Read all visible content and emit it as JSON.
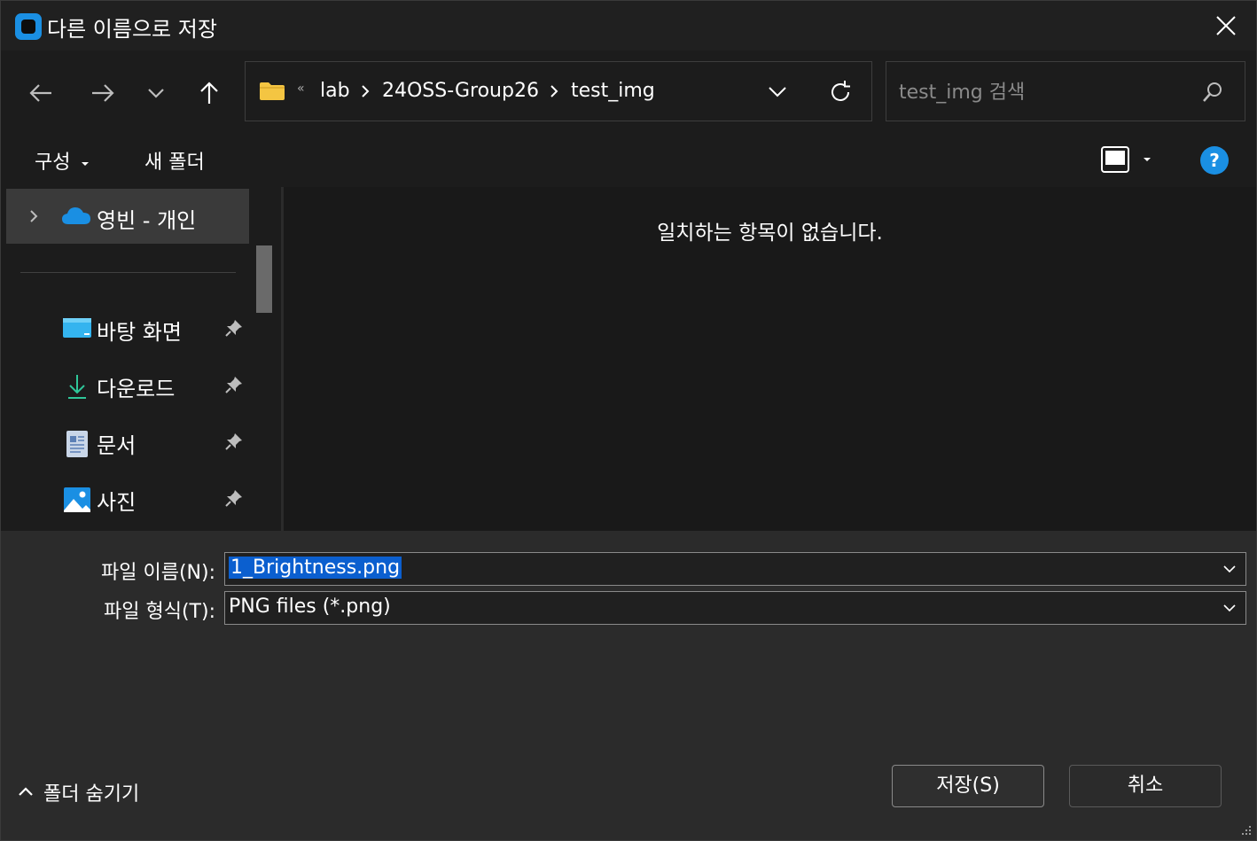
{
  "title": "다른 이름으로 저장",
  "nav": {
    "back": "arrow-left-icon",
    "forward": "arrow-right-icon",
    "recent": "chevron-down-icon",
    "up": "arrow-up-icon"
  },
  "address": {
    "overflow": "«",
    "crumbs": [
      "lab",
      "24OSS-Group26",
      "test_img"
    ]
  },
  "search": {
    "placeholder": "test_img 검색"
  },
  "toolbar": {
    "organize": "구성",
    "new_folder": "새 폴더",
    "help": "?"
  },
  "sidebar": {
    "onedrive": "영빈 - 개인",
    "quick_access": [
      {
        "label": "바탕 화면",
        "icon": "desktop-icon"
      },
      {
        "label": "다운로드",
        "icon": "download-icon"
      },
      {
        "label": "문서",
        "icon": "documents-icon"
      },
      {
        "label": "사진",
        "icon": "pictures-icon"
      }
    ]
  },
  "content": {
    "empty_message": "일치하는 항목이 없습니다."
  },
  "bottom": {
    "filename_label": "파일 이름(N):",
    "filename_value": "1_Brightness.png",
    "filetype_label": "파일 형식(T):",
    "filetype_value": "PNG files (*.png)",
    "hide_folders": "폴더 숨기기",
    "save": "저장(S)",
    "cancel": "취소"
  },
  "colors": {
    "accent": "#1a8fe3",
    "selection": "#0b5fcf",
    "folder": "#f4c542"
  }
}
